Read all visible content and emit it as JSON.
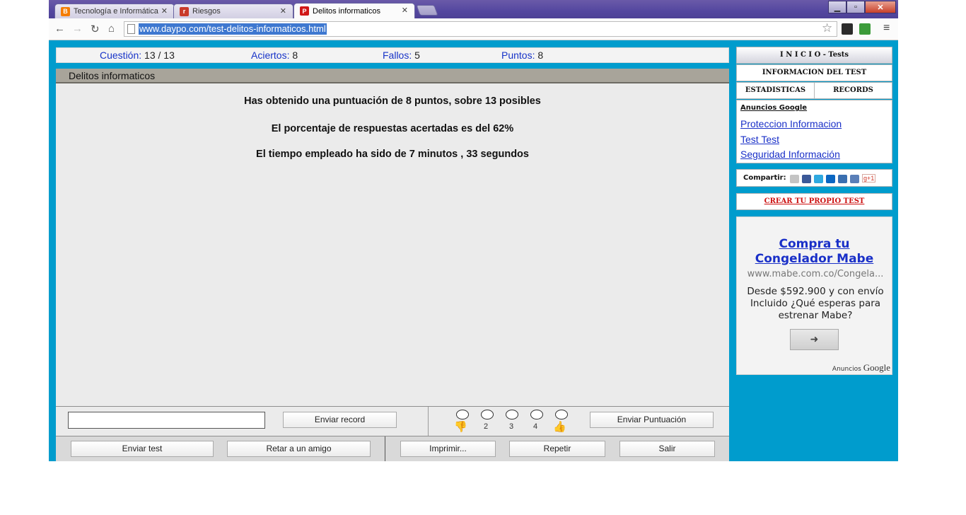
{
  "browser": {
    "tabs": [
      {
        "title": "Tecnología e Informática"
      },
      {
        "title": "Riesgos"
      },
      {
        "title": "Delitos informaticos"
      }
    ],
    "url": "www.daypo.com/test-delitos-informaticos.html"
  },
  "stats": {
    "question_label": "Cuestión:",
    "question_value": "13 / 13",
    "hits_label": "Aciertos:",
    "hits_value": "8",
    "fails_label": "Fallos:",
    "fails_value": "5",
    "points_label": "Puntos:",
    "points_value": "8"
  },
  "panel": {
    "title": "Delitos informaticos",
    "line1": "Has obtenido una puntuación de 8 puntos, sobre 13 posibles",
    "line2": "El porcentaje de respuestas acertadas es del 62%",
    "line3": "El tiempo empleado ha sido de 7 minutos , 33 segundos"
  },
  "record": {
    "send_record": "Enviar record",
    "rating_numbers": [
      "2",
      "3",
      "4"
    ],
    "send_score": "Enviar Puntuación"
  },
  "actions": {
    "send_test": "Enviar test",
    "challenge": "Retar a un amigo",
    "print": "Imprimir...",
    "repeat": "Repetir",
    "exit": "Salir"
  },
  "sidebar": {
    "home": "I N I C I O - Tests",
    "info": "INFORMACION DEL TEST",
    "stats": "ESTADISTICAS",
    "records": "RECORDS",
    "ads_label": "Anuncios Google",
    "links": [
      "Proteccion Informacion",
      "Test Test",
      "Seguridad Información"
    ],
    "share_label": "Compartir:",
    "share_gplus": "g+1",
    "create": "CREAR TU PROPIO TEST"
  },
  "ad": {
    "title_line1": "Compra tu",
    "title_line2": "Congelador Mabe",
    "url": "www.mabe.com.co/Congela...",
    "body": "Desde $592.900 y con envío Incluido ¿Qué esperas para estrenar Mabe?",
    "footer_prefix": "Anuncios",
    "footer_brand": "Google"
  },
  "colors": {
    "frame": "#009ccd",
    "label_blue": "#1733c8",
    "link_blue": "#1a30c8",
    "create_red": "#cc1010"
  }
}
